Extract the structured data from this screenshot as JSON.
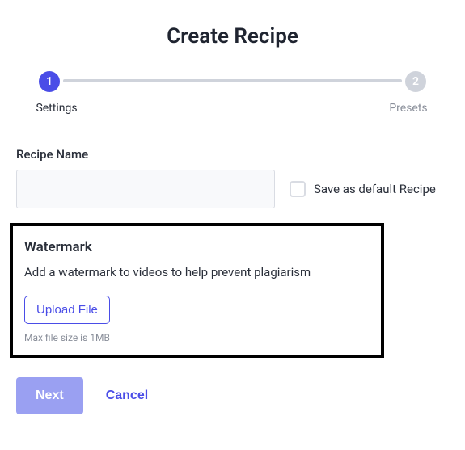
{
  "page": {
    "title": "Create Recipe"
  },
  "stepper": {
    "steps": [
      {
        "number": "1",
        "label": "Settings",
        "active": true
      },
      {
        "number": "2",
        "label": "Presets",
        "active": false
      }
    ]
  },
  "recipeName": {
    "label": "Recipe Name",
    "value": "",
    "placeholder": ""
  },
  "saveDefault": {
    "label": "Save as default Recipe",
    "checked": false
  },
  "watermark": {
    "title": "Watermark",
    "description": "Add a watermark to videos to help prevent plagiarism",
    "uploadLabel": "Upload File",
    "hint": "Max file size is 1MB"
  },
  "actions": {
    "next": "Next",
    "cancel": "Cancel"
  }
}
